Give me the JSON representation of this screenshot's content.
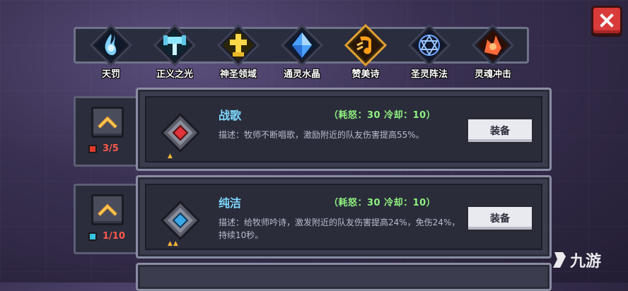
{
  "tabs": [
    {
      "label": "天罚",
      "icon": "blue-flame-icon",
      "color": "#7fd0ff"
    },
    {
      "label": "正义之光",
      "icon": "hammer-icon",
      "color": "#8fe7ff"
    },
    {
      "label": "神圣领域",
      "icon": "holy-cross-icon",
      "color": "#ffd84a"
    },
    {
      "label": "通灵水晶",
      "icon": "crystal-icon",
      "color": "#7fc3ff"
    },
    {
      "label": "赞美诗",
      "icon": "music-note-icon",
      "color": "#ff9d1a"
    },
    {
      "label": "圣灵阵法",
      "icon": "magic-circle-icon",
      "color": "#6fa9ff"
    },
    {
      "label": "灵魂冲击",
      "icon": "soul-blast-icon",
      "color": "#ff6a3a"
    }
  ],
  "active_tab": 4,
  "skills": [
    {
      "name": "战歌",
      "cost": "（耗怒：30  冷却：10）",
      "desc": "描述：牧师不断唱歌，激励附近的队友伤害提高55%。",
      "equip_label": "装备",
      "level": "3/5",
      "gem_color": "#e0353a",
      "book_color": "#e03a2a",
      "level_color": "#ff5a4a",
      "stars": "▲"
    },
    {
      "name": "纯洁",
      "cost": "（耗怒：30  冷却：10）",
      "desc": "描述：给牧师吟诗，激发附近的队友伤害提高24%，免伤24%，持续10秒。",
      "equip_label": "装备",
      "level": "1/10",
      "gem_color": "#3aa8e8",
      "book_color": "#37c4e0",
      "level_color": "#ff5a4a",
      "stars": "▲▲"
    }
  ],
  "watermark": "九游"
}
